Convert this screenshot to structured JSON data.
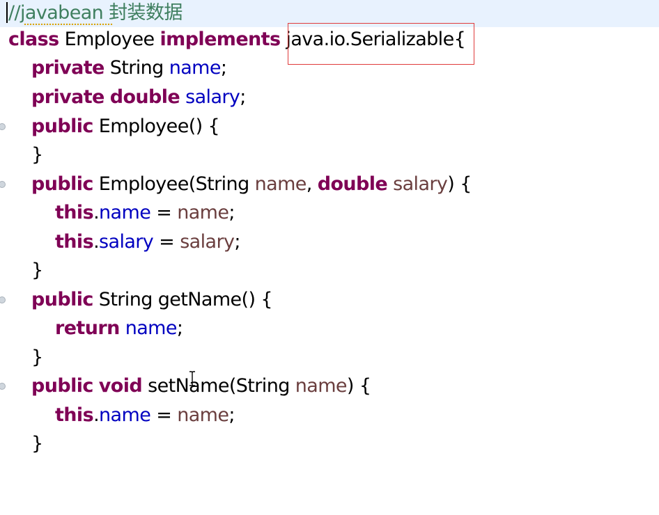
{
  "editor": {
    "colors": {
      "keyword": "#7f0055",
      "field": "#0000c0",
      "parameter": "#6a3e3e",
      "comment": "#3f7f5f",
      "current_line": "#e8f2fe",
      "highlight_box": "#e03a3a"
    },
    "lines": [
      {
        "tokens": [
          {
            "t": "//javabean 封装数据",
            "c": "cmt"
          }
        ]
      },
      {
        "tokens": [
          {
            "t": "class",
            "c": "kw"
          },
          {
            "t": " Employee ",
            "c": "plain"
          },
          {
            "t": "implements",
            "c": "kw"
          },
          {
            "t": " java.io.Serializable",
            "c": "plain"
          },
          {
            "t": "{",
            "c": "plain"
          }
        ]
      },
      {
        "tokens": [
          {
            "t": "private",
            "c": "kw"
          },
          {
            "t": " String ",
            "c": "plain"
          },
          {
            "t": "name",
            "c": "fld"
          },
          {
            "t": ";",
            "c": "plain"
          }
        ]
      },
      {
        "tokens": [
          {
            "t": "private",
            "c": "kw"
          },
          {
            "t": " ",
            "c": "plain"
          },
          {
            "t": "double",
            "c": "kw"
          },
          {
            "t": " ",
            "c": "plain"
          },
          {
            "t": "salary",
            "c": "fld"
          },
          {
            "t": ";",
            "c": "plain"
          }
        ]
      },
      {
        "tokens": [
          {
            "t": "public",
            "c": "kw"
          },
          {
            "t": " Employee() {",
            "c": "plain"
          }
        ]
      },
      {
        "tokens": [
          {
            "t": "}",
            "c": "plain"
          }
        ]
      },
      {
        "tokens": [
          {
            "t": "public",
            "c": "kw"
          },
          {
            "t": " Employee(String ",
            "c": "plain"
          },
          {
            "t": "name",
            "c": "prm"
          },
          {
            "t": ", ",
            "c": "plain"
          },
          {
            "t": "double",
            "c": "kw"
          },
          {
            "t": " ",
            "c": "plain"
          },
          {
            "t": "salary",
            "c": "prm"
          },
          {
            "t": ") {",
            "c": "plain"
          }
        ]
      },
      {
        "tokens": [
          {
            "t": "this",
            "c": "kw"
          },
          {
            "t": ".",
            "c": "plain"
          },
          {
            "t": "name",
            "c": "fld"
          },
          {
            "t": " = ",
            "c": "plain"
          },
          {
            "t": "name",
            "c": "prm"
          },
          {
            "t": ";",
            "c": "plain"
          }
        ]
      },
      {
        "tokens": [
          {
            "t": "this",
            "c": "kw"
          },
          {
            "t": ".",
            "c": "plain"
          },
          {
            "t": "salary",
            "c": "fld"
          },
          {
            "t": " = ",
            "c": "plain"
          },
          {
            "t": "salary",
            "c": "prm"
          },
          {
            "t": ";",
            "c": "plain"
          }
        ]
      },
      {
        "tokens": [
          {
            "t": "}",
            "c": "plain"
          }
        ]
      },
      {
        "tokens": [
          {
            "t": "public",
            "c": "kw"
          },
          {
            "t": " String getName() {",
            "c": "plain"
          }
        ]
      },
      {
        "tokens": [
          {
            "t": "return",
            "c": "kw"
          },
          {
            "t": " ",
            "c": "plain"
          },
          {
            "t": "name",
            "c": "fld"
          },
          {
            "t": ";",
            "c": "plain"
          }
        ]
      },
      {
        "tokens": [
          {
            "t": "}",
            "c": "plain"
          }
        ]
      },
      {
        "tokens": [
          {
            "t": "public",
            "c": "kw"
          },
          {
            "t": " ",
            "c": "plain"
          },
          {
            "t": "void",
            "c": "kw"
          },
          {
            "t": " setName(String ",
            "c": "plain"
          },
          {
            "t": "name",
            "c": "prm"
          },
          {
            "t": ") {",
            "c": "plain"
          }
        ]
      },
      {
        "tokens": [
          {
            "t": "this",
            "c": "kw"
          },
          {
            "t": ".",
            "c": "plain"
          },
          {
            "t": "name",
            "c": "fld"
          },
          {
            "t": " = ",
            "c": "plain"
          },
          {
            "t": "name",
            "c": "prm"
          },
          {
            "t": ";",
            "c": "plain"
          }
        ]
      },
      {
        "tokens": [
          {
            "t": "}",
            "c": "plain"
          }
        ]
      }
    ]
  }
}
